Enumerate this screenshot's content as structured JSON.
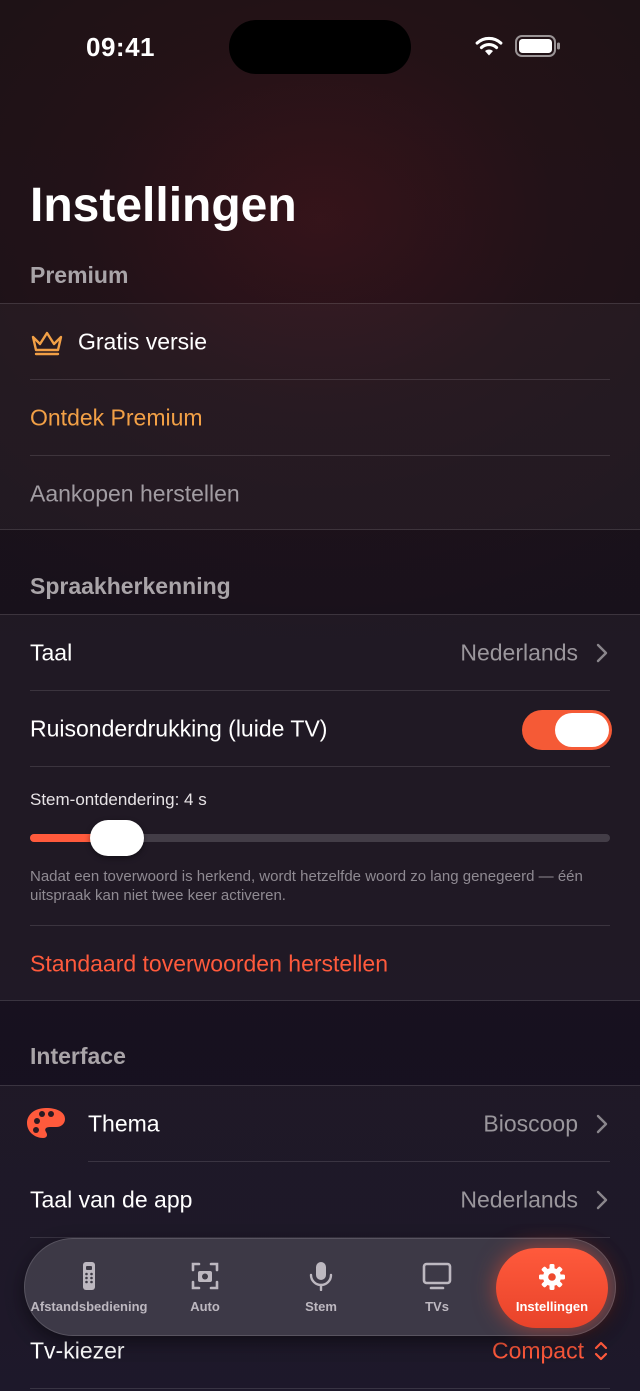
{
  "status_bar": {
    "time": "09:41"
  },
  "page_title": "Instellingen",
  "sections": {
    "premium": {
      "header": "Premium",
      "free_version": "Gratis versie",
      "discover": "Ontdek Premium",
      "restore": "Aankopen herstellen"
    },
    "speech": {
      "header": "Spraakherkenning",
      "language_label": "Taal",
      "language_value": "Nederlands",
      "noise_label": "Ruisonderdrukking (luide TV)",
      "noise_enabled": true,
      "debounce_label": "Stem-ontdendering: 4 s",
      "debounce_fraction": 0.15,
      "footnote": "Nadat een toverwoord is herkend, wordt hetzelfde woord zo lang genegeerd — één uitspraak kan niet twee keer activeren.",
      "reset_words": "Standaard toverwoorden herstellen"
    },
    "interface": {
      "header": "Interface",
      "theme_label": "Thema",
      "theme_value": "Bioscoop",
      "app_language_label": "Taal van de app",
      "app_language_value": "Nederlands",
      "tv_picker_label": "Tv-kiezer",
      "tv_picker_value": "Compact"
    }
  },
  "tab_bar": {
    "tabs": [
      {
        "label": "Afstandsbediening",
        "icon": "remote-icon"
      },
      {
        "label": "Auto",
        "icon": "camera-scan-icon"
      },
      {
        "label": "Stem",
        "icon": "microphone-icon"
      },
      {
        "label": "TVs",
        "icon": "tv-icon"
      },
      {
        "label": "Instellingen",
        "icon": "gear-icon",
        "active": true
      }
    ]
  },
  "colors": {
    "accent": "#ff5a3c",
    "premium_orange": "#f2a046",
    "section_header": "#a9a4a8"
  }
}
